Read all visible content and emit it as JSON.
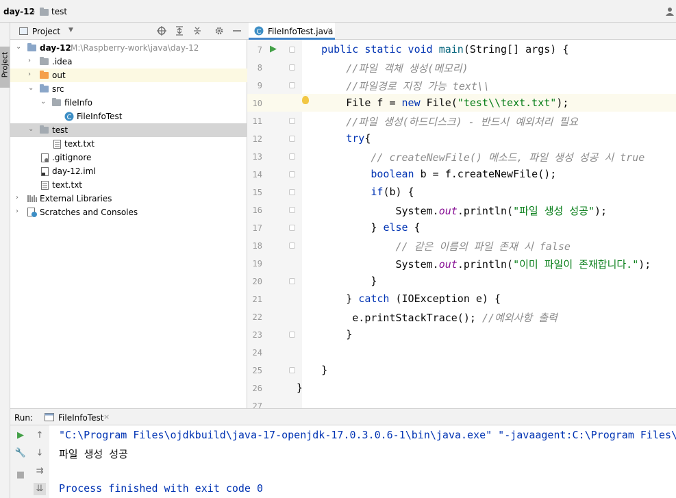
{
  "breadcrumb": {
    "project": "day-12",
    "folder": "test"
  },
  "sidebar_stripe": {
    "label": "Project"
  },
  "project_panel": {
    "title": "Project",
    "tree": [
      {
        "label": "day-12",
        "path": "M:\\Raspberry-work\\java\\day-12"
      },
      {
        "label": ".idea"
      },
      {
        "label": "out"
      },
      {
        "label": "src"
      },
      {
        "label": "fileInfo"
      },
      {
        "label": "FileInfoTest"
      },
      {
        "label": "test"
      },
      {
        "label": "text.txt"
      },
      {
        "label": ".gitignore"
      },
      {
        "label": "day-12.iml"
      },
      {
        "label": "text.txt"
      },
      {
        "label": "External Libraries"
      },
      {
        "label": "Scratches and Consoles"
      }
    ]
  },
  "editor": {
    "tab_label": "FileInfoTest.java",
    "line_numbers": [
      "7",
      "8",
      "9",
      "10",
      "11",
      "12",
      "13",
      "14",
      "15",
      "16",
      "17",
      "18",
      "19",
      "20",
      "21",
      "22",
      "23",
      "24",
      "25",
      "26",
      "27"
    ],
    "lines": [
      [
        "    ",
        "public static void ",
        "main",
        "(String[] args) {"
      ],
      [
        "        ",
        "//파일 객체 생성(메모리)"
      ],
      [
        "        ",
        "//파일경로 지정 가능 text\\\\"
      ],
      [
        "        File f = ",
        "new ",
        "File(",
        "\"test\\\\text.txt\"",
        ");"
      ],
      [
        "        ",
        "//파일 생성(하드디스크) - 반드시 예외처리 필요"
      ],
      [
        "        ",
        "try",
        "{"
      ],
      [
        "            ",
        "// createNewFile() 메소드, 파일 생성 성공 시 true"
      ],
      [
        "            ",
        "boolean ",
        "b = f.createNewFile();"
      ],
      [
        "            ",
        "if",
        "(b) {"
      ],
      [
        "                System.",
        "out",
        ".println(",
        "\"파일 생성 성공\"",
        ");"
      ],
      [
        "            } ",
        "else ",
        "{"
      ],
      [
        "                ",
        "// 같은 이름의 파일 존재 시 false"
      ],
      [
        "                System.",
        "out",
        ".println(",
        "\"이미 파일이 존재합니다.\"",
        ");"
      ],
      [
        "            }"
      ],
      [
        "        } ",
        "catch ",
        "(IOException e) {"
      ],
      [
        "         e.printStackTrace(); ",
        "//예외사항 출력"
      ],
      [
        "        }"
      ],
      [
        ""
      ],
      [
        "    }"
      ],
      [
        "}"
      ],
      [
        ""
      ]
    ]
  },
  "run": {
    "label": "Run:",
    "tab_label": "FileInfoTest",
    "console": [
      "\"C:\\Program Files\\ojdkbuild\\java-17-openjdk-17.0.3.0.6-1\\bin\\java.exe\" \"-javaagent:C:\\Program Files\\",
      "파일 생성 성공",
      "",
      "Process finished with exit code 0"
    ]
  },
  "colors": {
    "keyword": "#0033b3",
    "string": "#067d17",
    "comment": "#8c8c8c",
    "method": "#00627a",
    "field": "#871094",
    "accent": "#4083c9"
  }
}
